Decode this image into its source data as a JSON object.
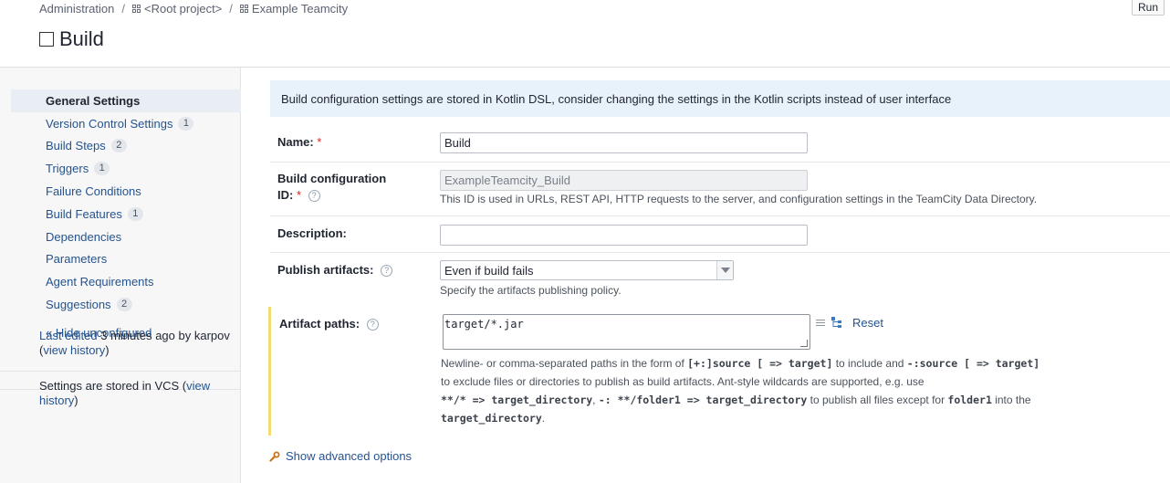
{
  "breadcrumb": {
    "admin": "Administration",
    "separator": "/",
    "root_project": "<Root project>",
    "project": "Example Teamcity"
  },
  "page": {
    "title": "Build",
    "run_label": "Run"
  },
  "sidebar": {
    "items": [
      {
        "label": "General Settings",
        "badge": ""
      },
      {
        "label": "Version Control Settings",
        "badge": "1"
      },
      {
        "label": "Build Steps",
        "badge": "2"
      },
      {
        "label": "Triggers",
        "badge": "1"
      },
      {
        "label": "Failure Conditions",
        "badge": ""
      },
      {
        "label": "Build Features",
        "badge": "1"
      },
      {
        "label": "Dependencies",
        "badge": ""
      },
      {
        "label": "Parameters",
        "badge": ""
      },
      {
        "label": "Agent Requirements",
        "badge": ""
      },
      {
        "label": "Suggestions",
        "badge": "2"
      }
    ],
    "hide_unconfigured": "« Hide unconfigured",
    "last_edited_prefix": "Last edited",
    "last_edited_time": "3 minutes ago by karpov",
    "view_history": "view history",
    "vcs_note_prefix": "Settings are stored in VCS (",
    "vcs_view_history": "view history",
    "vcs_suffix": ")"
  },
  "banner": "Build configuration settings are stored in Kotlin DSL, consider changing the settings in the Kotlin scripts instead of user interface",
  "form": {
    "name": {
      "label": "Name:",
      "required": "*",
      "value": "Build"
    },
    "config_id": {
      "label_line1": "Build configuration",
      "label_line2": "ID:",
      "required": "*",
      "value": "ExampleTeamcity_Build",
      "hint": "This ID is used in URLs, REST API, HTTP requests to the server, and configuration settings in the TeamCity Data Directory."
    },
    "description": {
      "label": "Description:",
      "value": ""
    },
    "publish": {
      "label": "Publish artifacts:",
      "value": "Even if build fails",
      "hint": "Specify the artifacts publishing policy."
    },
    "artifacts": {
      "label": "Artifact paths:",
      "value": "target/*.jar",
      "reset": "Reset",
      "hint_1a": "Newline- or comma-separated paths in the form of ",
      "hint_1b": "[+:]source [ => target]",
      "hint_1c": " to include and ",
      "hint_1d": "-:source [ => target]",
      "hint_2": "to exclude files or directories to publish as build artifacts. Ant-style wildcards are supported, e.g. use",
      "hint_3a": "**/* => target_directory",
      "hint_3b": ", ",
      "hint_3c": "-: **/folder1 => target_directory",
      "hint_3d": " to publish all files except for ",
      "hint_3e": "folder1",
      "hint_3f": " into the",
      "hint_4a": "target_directory",
      "hint_4b": "."
    }
  },
  "advanced": "Show advanced options",
  "help_glyph": "?",
  "colors": {
    "link": "#24538f",
    "banner_bg": "#e8f2fa",
    "highlight_bar": "#f2dc72",
    "required": "#dd2222"
  }
}
